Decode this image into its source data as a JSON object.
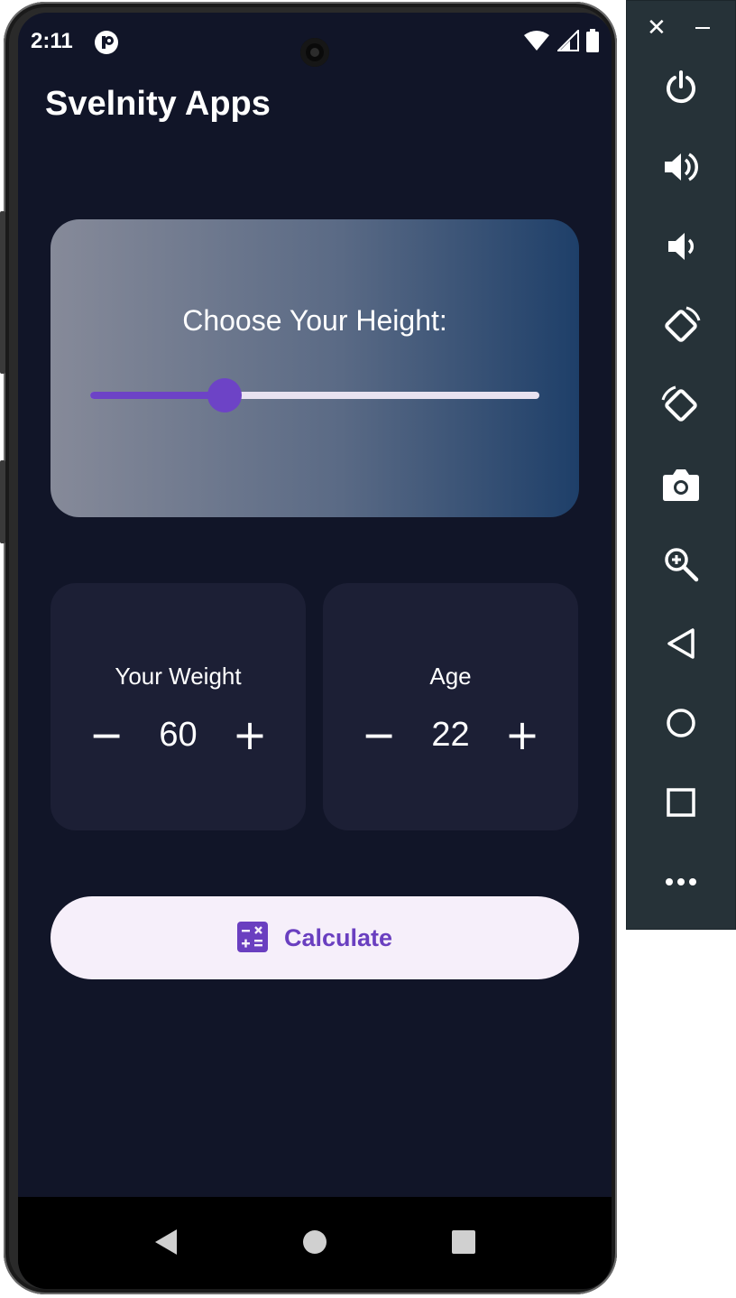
{
  "status_bar": {
    "time": "2:11",
    "app_icon": "app-notification-icon",
    "icons": [
      "wifi-icon",
      "signal-icon",
      "battery-icon"
    ]
  },
  "app": {
    "title": "Svelnity Apps"
  },
  "height_card": {
    "label": "Choose Your Height:",
    "slider_fraction": 0.3
  },
  "weight_card": {
    "label": "Your Weight",
    "value": "60",
    "minus_label": "−",
    "plus_label": "+"
  },
  "age_card": {
    "label": "Age",
    "value": "22",
    "minus_label": "−",
    "plus_label": "+"
  },
  "calculate_button": {
    "label": "Calculate",
    "icon": "calculator-icon"
  },
  "colors": {
    "background": "#111528",
    "card": "#1c1f35",
    "accent": "#6d43c6",
    "button_bg": "#f6effa",
    "button_text": "#6a3fc0"
  },
  "emulator_toolbar": {
    "items": [
      "power-icon",
      "volume-up-icon",
      "volume-down-icon",
      "rotate-left-icon",
      "rotate-right-icon",
      "camera-icon",
      "zoom-icon",
      "back-icon",
      "home-icon",
      "overview-icon",
      "more-icon"
    ]
  }
}
